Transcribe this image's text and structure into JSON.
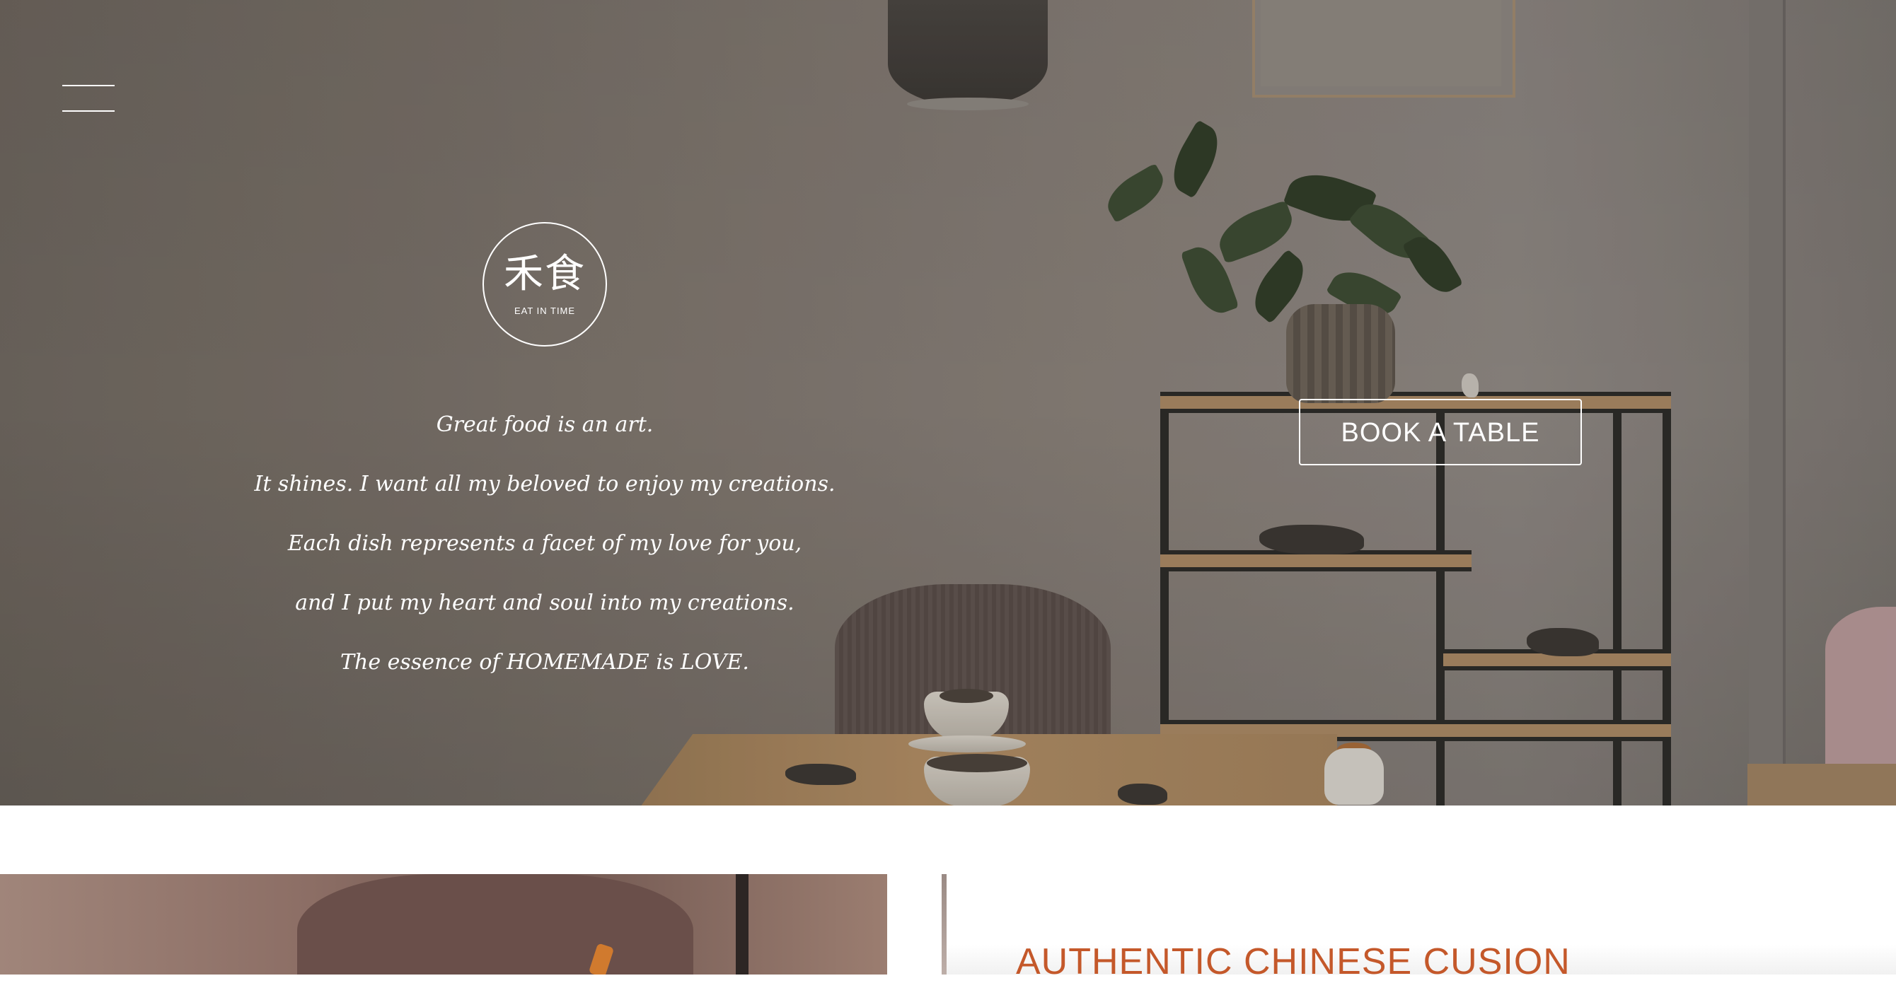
{
  "header": {
    "menu_icon": "hamburger-menu-icon"
  },
  "logo": {
    "chinese": "禾食",
    "english": "EAT IN TIME"
  },
  "tagline": {
    "lines": [
      "Great food is an art.",
      "It shines. I want all my beloved to enjoy my creations.",
      "Each dish represents a facet of my love for you,",
      "and I put my heart and soul into my creations.",
      "The essence of HOMEMADE is LOVE."
    ]
  },
  "cta": {
    "book_label": "BOOK A TABLE"
  },
  "about": {
    "title": "AUTHENTIC CHINESE CUSION"
  },
  "colors": {
    "accent": "#c4582a",
    "text_on_hero": "#ffffff"
  }
}
